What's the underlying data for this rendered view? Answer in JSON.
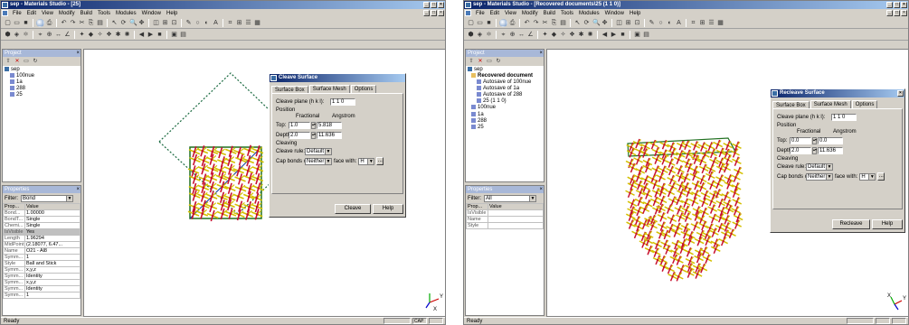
{
  "left": {
    "title": "sep - Materials Studio - [25]",
    "menu": [
      "File",
      "Edit",
      "View",
      "Modify",
      "Build",
      "Tools",
      "Modules",
      "Window",
      "Help"
    ],
    "project": {
      "header": "Project",
      "tree": [
        "sep",
        "100nue",
        "1a",
        "288",
        "25"
      ]
    },
    "properties": {
      "header": "Properties",
      "filter_label": "Filter:",
      "filter_value": "Bond",
      "col_prop": "Prop...",
      "col_value": "Value",
      "rows": [
        [
          "Bond...",
          "1.00000"
        ],
        [
          "BondT...",
          "Single"
        ],
        [
          "Chemi...",
          "Single"
        ],
        [
          "IsVisible",
          "Yes"
        ],
        [
          "Length",
          "1.96294"
        ],
        [
          "MidPoint",
          "(2.18077, 6.47..."
        ],
        [
          "Name",
          "O21 - Al8"
        ],
        [
          "Symm...",
          "1"
        ],
        [
          "Style",
          "Ball and Stick"
        ],
        [
          "Symm...",
          "x,y,z"
        ],
        [
          "Symm...",
          "Identity"
        ],
        [
          "Symm...",
          "x,y,z"
        ],
        [
          "Symm...",
          "Identity"
        ],
        [
          "Symm...",
          "1"
        ]
      ]
    },
    "dialog": {
      "title": "Cleave Surface",
      "tabs": [
        "Surface Box",
        "Surface Mesh",
        "Options"
      ],
      "cleave_plane_label": "Cleave plane (h k l):",
      "cleave_plane_value": "1  1  0",
      "position_label": "Position",
      "fractional_label": "Fractional",
      "angstrom_label": "Angstrom",
      "top_label": "Top:",
      "top_frac": "1.0",
      "top_ang": "5.818",
      "depth_label": "Depth:",
      "depth_frac": "2.0",
      "depth_ang": "11.636",
      "cleaving_label": "Cleaving",
      "cleave_rule_label": "Cleave rule:",
      "cleave_rule_value": "Default",
      "cap_label": "Cap bonds on:",
      "cap_value": "Neither",
      "face_label": "face with:",
      "face_value": "H",
      "more": "...",
      "primary_button": "Cleave",
      "help_button": "Help"
    },
    "status": "Ready",
    "status_cells": [
      "CAP",
      ""
    ],
    "axes": [
      "Y",
      "X"
    ]
  },
  "right": {
    "title": "sep - Materials Studio - [Recovered documents\\25 (1 1 0)]",
    "menu": [
      "File",
      "Edit",
      "View",
      "Modify",
      "Build",
      "Tools",
      "Modules",
      "Window",
      "Help"
    ],
    "project": {
      "header": "Project",
      "tree": [
        "sep",
        "Recovered document",
        "Autosave of 100nue",
        "Autosave of 1a",
        "Autosave of 288",
        "25 (1 1 0)",
        "100nue",
        "1a",
        "288",
        "25"
      ]
    },
    "properties": {
      "header": "Properties",
      "filter_label": "Filter:",
      "filter_value": "All",
      "col_prop": "Prop...",
      "col_value": "Value",
      "rows": [
        [
          "IsVisible",
          ""
        ],
        [
          "Name",
          ""
        ],
        [
          "Style",
          ""
        ]
      ]
    },
    "dialog": {
      "title": "Recleave Surface",
      "tabs": [
        "Surface Box",
        "Surface Mesh",
        "Options"
      ],
      "cleave_plane_label": "Cleave plane (h k l):",
      "cleave_plane_value": "1  1  0",
      "position_label": "Position",
      "fractional_label": "Fractional",
      "angstrom_label": "Angstrom",
      "top_label": "Top:",
      "top_frac": "0.0",
      "top_ang": "0.0",
      "depth_label": "Depth:",
      "depth_frac": "2.0",
      "depth_ang": "11.636",
      "cleaving_label": "Cleaving",
      "cleave_rule_label": "Cleave rule:",
      "cleave_rule_value": "Default",
      "cap_label": "Cap bonds on:",
      "cap_value": "Neither",
      "face_label": "face with:",
      "face_value": "H",
      "more": "...",
      "primary_button": "Recleave",
      "help_button": "Help"
    },
    "status": "Ready",
    "axes": [
      "Y",
      "X"
    ]
  },
  "colors": {
    "oxygen": "#c8102e",
    "aluminum": "#d4c000",
    "bond_green": "#207020",
    "titlebar": "#0a246a"
  },
  "icons": [
    "new-icon",
    "open-icon",
    "save-icon",
    "print-icon",
    "cut-icon",
    "copy-icon",
    "paste-icon",
    "undo-icon",
    "redo-icon",
    "select-icon",
    "rotate-icon",
    "zoom-icon",
    "translate-icon",
    "pen-icon",
    "eraser-icon",
    "build-icon"
  ]
}
